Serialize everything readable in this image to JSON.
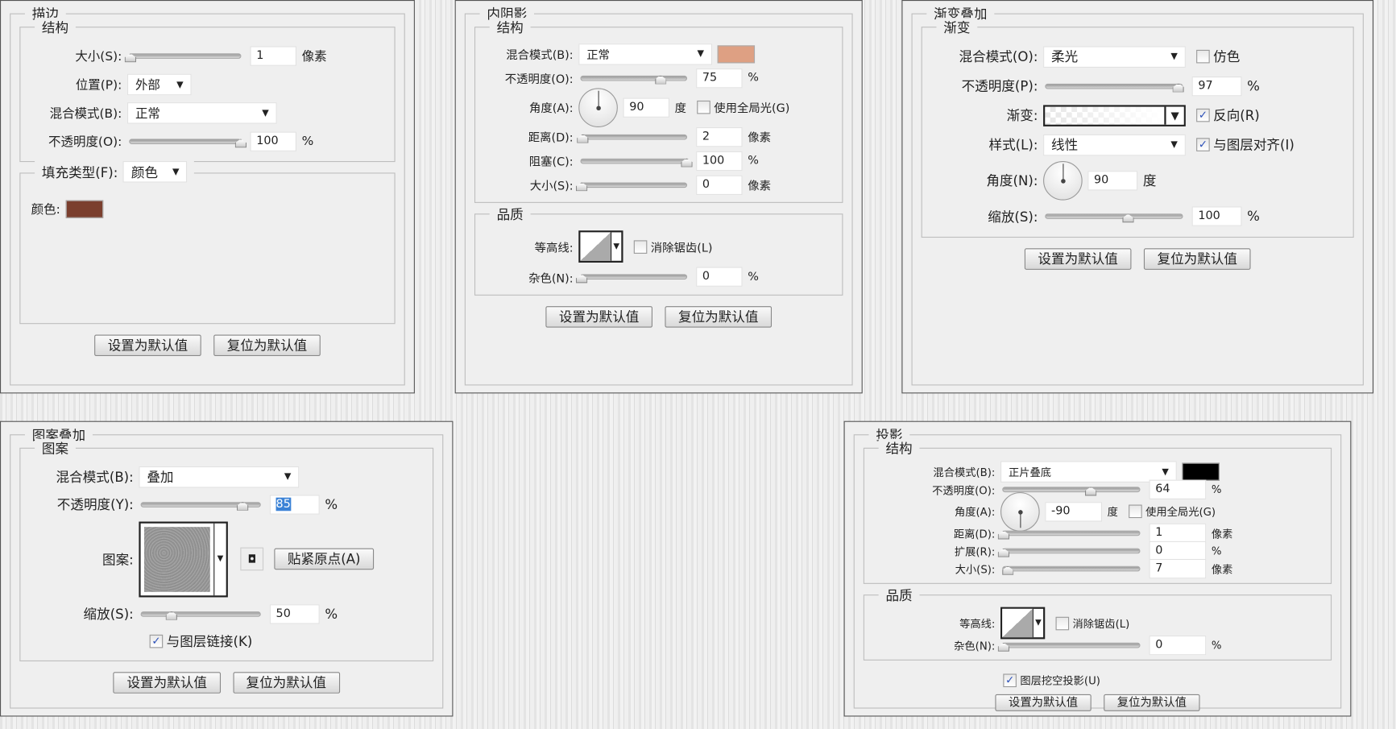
{
  "common": {
    "set_default": "设置为默认值",
    "reset_default": "复位为默认值"
  },
  "panels": [
    {
      "id": "stroke",
      "title": "描边",
      "groups": [
        {
          "legend": "结构",
          "rows": [
            {
              "type": "slider",
              "label": "大小(S):",
              "level": 0.0,
              "value": "1",
              "unit": "像素"
            },
            {
              "type": "select",
              "label": "位置(P):",
              "value": "外部",
              "size": "short"
            },
            {
              "type": "select",
              "label": "混合模式(B):",
              "value": "正常"
            },
            {
              "type": "slider",
              "label": "不透明度(O):",
              "level": 1.0,
              "value": "100",
              "unit": "%"
            }
          ]
        },
        {
          "legend_select": {
            "label": "填充类型(F):",
            "value": "颜色"
          },
          "rows": [
            {
              "type": "color",
              "label": "颜色:",
              "color": "#7b3f2e"
            }
          ]
        }
      ]
    },
    {
      "id": "inner-shadow",
      "title": "内阴影",
      "groups": [
        {
          "legend": "结构",
          "rows": [
            {
              "type": "select",
              "label": "混合模式(B):",
              "value": "正常",
              "swatch": "#dea083"
            },
            {
              "type": "slider",
              "label": "不透明度(O):",
              "level": 0.75,
              "value": "75",
              "unit": "%"
            },
            {
              "type": "angle",
              "label": "角度(A):",
              "value": "90",
              "unit": "度",
              "angle": 90,
              "checkbox": {
                "label": "使用全局光(G)",
                "checked": false
              }
            },
            {
              "type": "slider",
              "label": "距离(D):",
              "level": 0.01,
              "value": "2",
              "unit": "像素"
            },
            {
              "type": "slider",
              "label": "阻塞(C):",
              "level": 1.0,
              "value": "100",
              "unit": "%"
            },
            {
              "type": "slider",
              "label": "大小(S):",
              "level": 0.0,
              "value": "0",
              "unit": "像素"
            }
          ]
        },
        {
          "legend": "品质",
          "rows": [
            {
              "type": "contour",
              "label": "等高线:",
              "checkbox": {
                "label": "消除锯齿(L)",
                "checked": false
              }
            },
            {
              "type": "slider",
              "label": "杂色(N):",
              "level": 0.0,
              "value": "0",
              "unit": "%"
            }
          ]
        }
      ]
    },
    {
      "id": "gradient-overlay",
      "title": "渐变叠加",
      "groups": [
        {
          "legend": "渐变",
          "rows": [
            {
              "type": "select",
              "label": "混合模式(O):",
              "value": "柔光",
              "checkbox": {
                "label": "仿色",
                "checked": false
              }
            },
            {
              "type": "slider",
              "label": "不透明度(P):",
              "level": 0.97,
              "value": "97",
              "unit": "%"
            },
            {
              "type": "gradient",
              "label": "渐变:",
              "checkbox": {
                "label": "反向(R)",
                "checked": true
              }
            },
            {
              "type": "select",
              "label": "样式(L):",
              "value": "线性",
              "checkbox": {
                "label": "与图层对齐(I)",
                "checked": true
              }
            },
            {
              "type": "angle",
              "label": "角度(N):",
              "value": "90",
              "unit": "度",
              "angle": 90
            },
            {
              "type": "slider",
              "label": "缩放(S):",
              "level": 0.6,
              "value": "100",
              "unit": "%"
            }
          ]
        }
      ]
    },
    {
      "id": "pattern-overlay",
      "title": "图案叠加",
      "groups": [
        {
          "legend": "图案",
          "rows": [
            {
              "type": "select",
              "label": "混合模式(B):",
              "value": "叠加"
            },
            {
              "type": "slider",
              "label": "不透明度(Y):",
              "level": 0.85,
              "value": "85",
              "unit": "%",
              "selected": true
            },
            {
              "type": "pattern",
              "label": "图案:",
              "button": "贴紧原点(A)"
            },
            {
              "type": "slider",
              "label": "缩放(S):",
              "level": 0.25,
              "value": "50",
              "unit": "%"
            },
            {
              "type": "checkbox",
              "label": "与图层链接(K)",
              "checked": true
            }
          ]
        }
      ]
    },
    {
      "id": "drop-shadow",
      "title": "投影",
      "groups": [
        {
          "legend": "结构",
          "rows": [
            {
              "type": "select",
              "label": "混合模式(B):",
              "value": "正片叠底",
              "swatch": "#000000"
            },
            {
              "type": "slider",
              "label": "不透明度(O):",
              "level": 0.64,
              "value": "64",
              "unit": "%"
            },
            {
              "type": "angle",
              "label": "角度(A):",
              "value": "-90",
              "unit": "度",
              "angle": -90,
              "checkbox": {
                "label": "使用全局光(G)",
                "checked": false
              }
            },
            {
              "type": "slider",
              "label": "距离(D):",
              "level": 0.0,
              "value": "1",
              "unit": "像素"
            },
            {
              "type": "slider",
              "label": "扩展(R):",
              "level": 0.0,
              "value": "0",
              "unit": "%"
            },
            {
              "type": "slider",
              "label": "大小(S):",
              "level": 0.03,
              "value": "7",
              "unit": "像素"
            }
          ]
        },
        {
          "legend": "品质",
          "rows": [
            {
              "type": "contour",
              "label": "等高线:",
              "checkbox": {
                "label": "消除锯齿(L)",
                "checked": false
              }
            },
            {
              "type": "slider",
              "label": "杂色(N):",
              "level": 0.0,
              "value": "0",
              "unit": "%"
            }
          ]
        },
        {
          "rows": [
            {
              "type": "checkbox",
              "label": "图层挖空投影(U)",
              "checked": true
            }
          ],
          "plain": true
        }
      ]
    }
  ]
}
